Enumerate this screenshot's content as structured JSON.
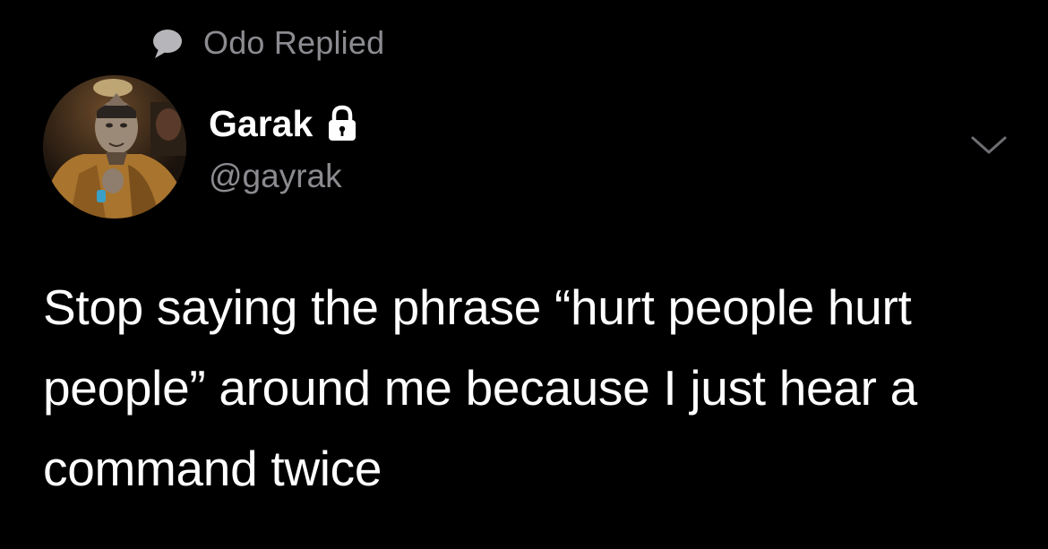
{
  "context": {
    "icon": "speech-bubble-icon",
    "text": "Odo Replied"
  },
  "author": {
    "avatar": "avatar-photo",
    "display_name": "Garak",
    "protected_icon": "lock-icon",
    "handle": "@gayrak"
  },
  "menu": {
    "icon": "chevron-down-icon"
  },
  "tweet": {
    "text": "Stop saying the phrase “hurt people hurt people” around me because I just hear a command twice"
  },
  "colors": {
    "background": "#000000",
    "primary_text": "#ffffff",
    "secondary_text": "#8b8b90"
  }
}
